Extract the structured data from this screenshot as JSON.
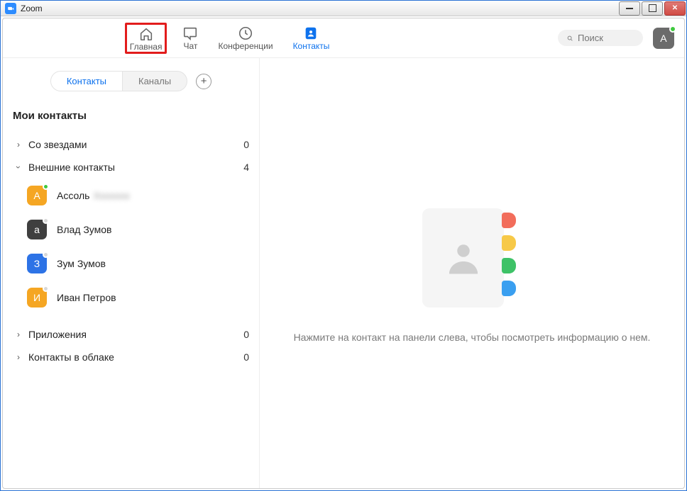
{
  "window": {
    "title": "Zoom"
  },
  "nav": {
    "home": "Главная",
    "chat": "Чат",
    "meetings": "Конференции",
    "contacts": "Контакты"
  },
  "search": {
    "placeholder": "Поиск"
  },
  "user_avatar": {
    "initial": "A"
  },
  "sidebar": {
    "segmented": {
      "contacts": "Контакты",
      "channels": "Каналы"
    },
    "section_title": "Мои контакты",
    "groups": {
      "starred": {
        "label": "Со звездами",
        "count": "0",
        "expanded": false
      },
      "external": {
        "label": "Внешние контакты",
        "count": "4",
        "expanded": true
      },
      "apps": {
        "label": "Приложения",
        "count": "0",
        "expanded": false
      },
      "cloud": {
        "label": "Контакты в облаке",
        "count": "0",
        "expanded": false
      }
    },
    "contacts": [
      {
        "initial": "А",
        "name": "Ассоль",
        "blurred_surname": "Xxxxxxx",
        "avatar_color": "#f5a623",
        "presence": "#3ec93e"
      },
      {
        "initial": "а",
        "name": "Влад Зумов",
        "avatar_color": "#3f3f3f",
        "presence": "#d8d8d8"
      },
      {
        "initial": "З",
        "name": "Зум Зумов",
        "avatar_color": "#2d73e6",
        "presence": "#d8d8d8"
      },
      {
        "initial": "И",
        "name": "Иван Петров",
        "avatar_color": "#f5a623",
        "presence": "#d8d8d8"
      }
    ]
  },
  "main": {
    "hint": "Нажмите на контакт на панели слева, чтобы посмотреть информацию о нем."
  }
}
